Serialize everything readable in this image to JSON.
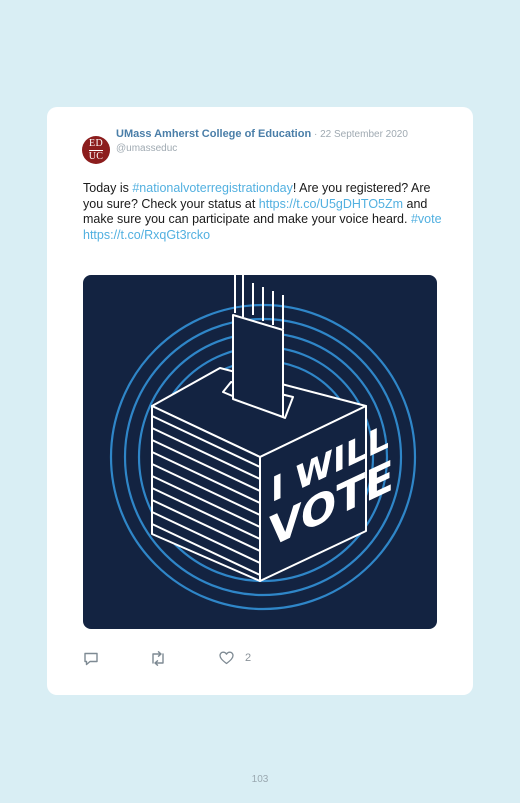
{
  "tweet": {
    "avatar_top": "ED",
    "avatar_bottom": "UC",
    "author": "UMass Amherst College of Education",
    "separator": " · ",
    "date": "22 September 2020",
    "handle": "@umasseduc",
    "text": {
      "p1": "Today is ",
      "hashtag1": "#nationalvoterregistrationday",
      "p2": "! Are you registered? Are you sure? Check your status at ",
      "link1": "https://t.co/U5gDHTO5Zm",
      "p3": " and make sure you can participate and make your voice heard. ",
      "hashtag2": "#vote",
      "p4": " ",
      "link2": "https://t.co/RxqGt3rcko"
    },
    "image": {
      "line1": "I WILL",
      "line2": "VOTE",
      "colors": {
        "background": "#132341",
        "rings": "#2f86c8",
        "box": "#ffffff"
      }
    },
    "actions": {
      "reply_icon": "reply-icon",
      "retweet_icon": "retweet-icon",
      "like_icon": "heart-icon",
      "like_count": "2"
    }
  },
  "page": {
    "number": "103"
  },
  "colors": {
    "page_background": "#d9eef4",
    "link": "#52b0e0",
    "author": "#4a7ea8"
  }
}
